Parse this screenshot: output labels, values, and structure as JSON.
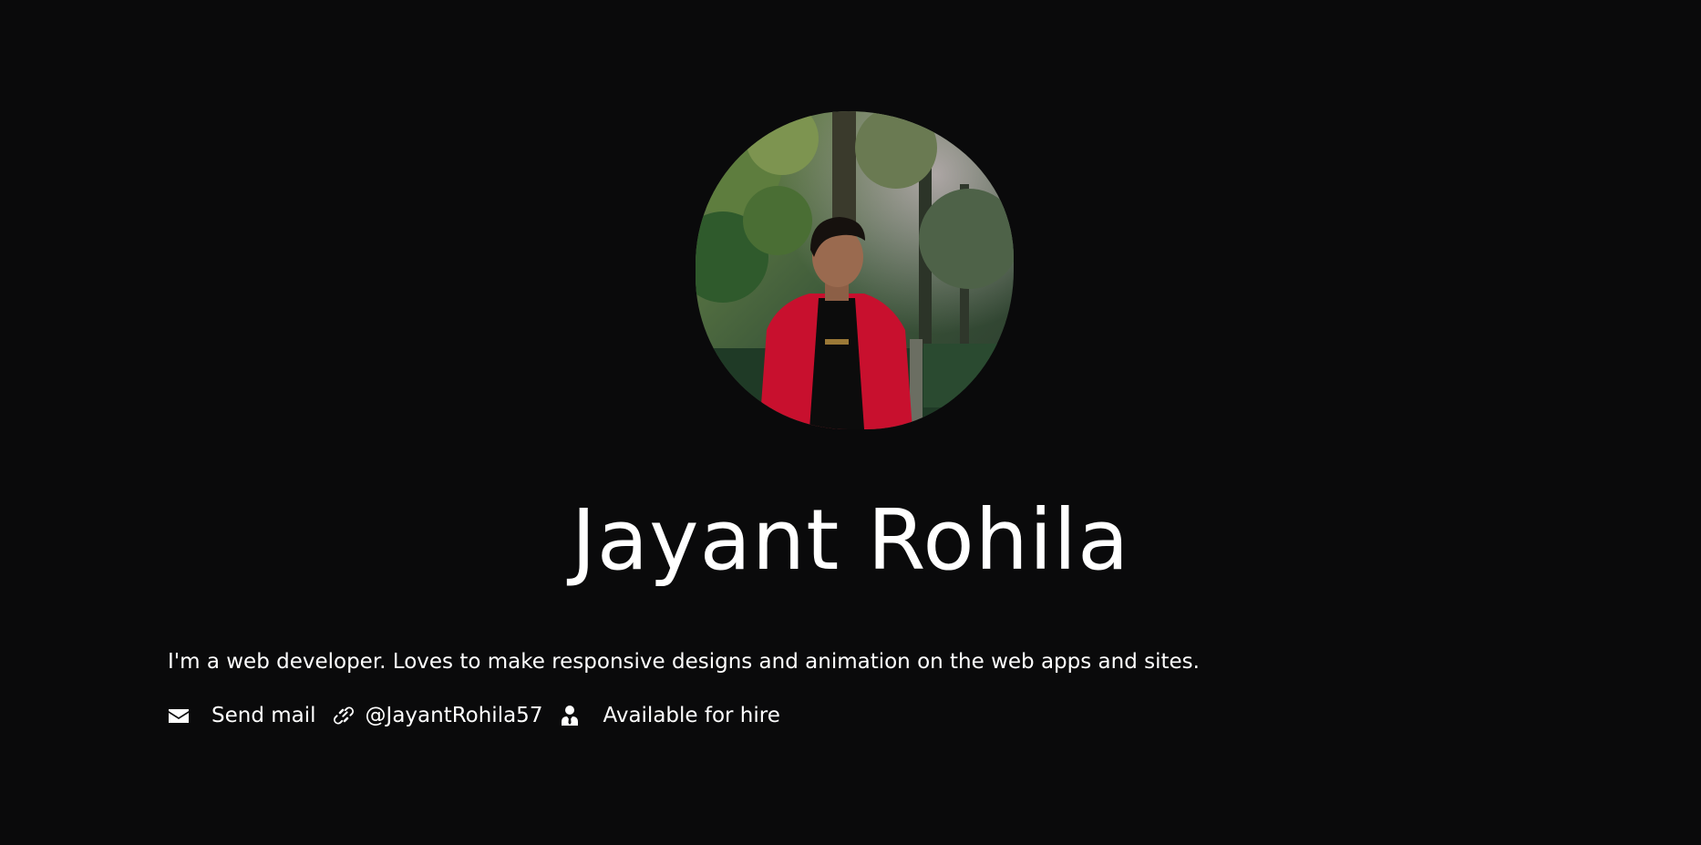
{
  "profile": {
    "name": "Jayant Rohila",
    "bio": "I'm a web developer. Loves to make responsive designs and animation on the web apps and sites."
  },
  "links": {
    "mail_label": "Send mail",
    "mail_icon": "envelope-icon",
    "handle_label": "@JayantRohila57",
    "handle_icon": "link-icon",
    "hire_label": "Available for hire",
    "hire_icon": "user-tie-icon"
  },
  "colors": {
    "background": "#0a0a0b",
    "text": "#ffffff",
    "jacket_red": "#c8102e"
  }
}
